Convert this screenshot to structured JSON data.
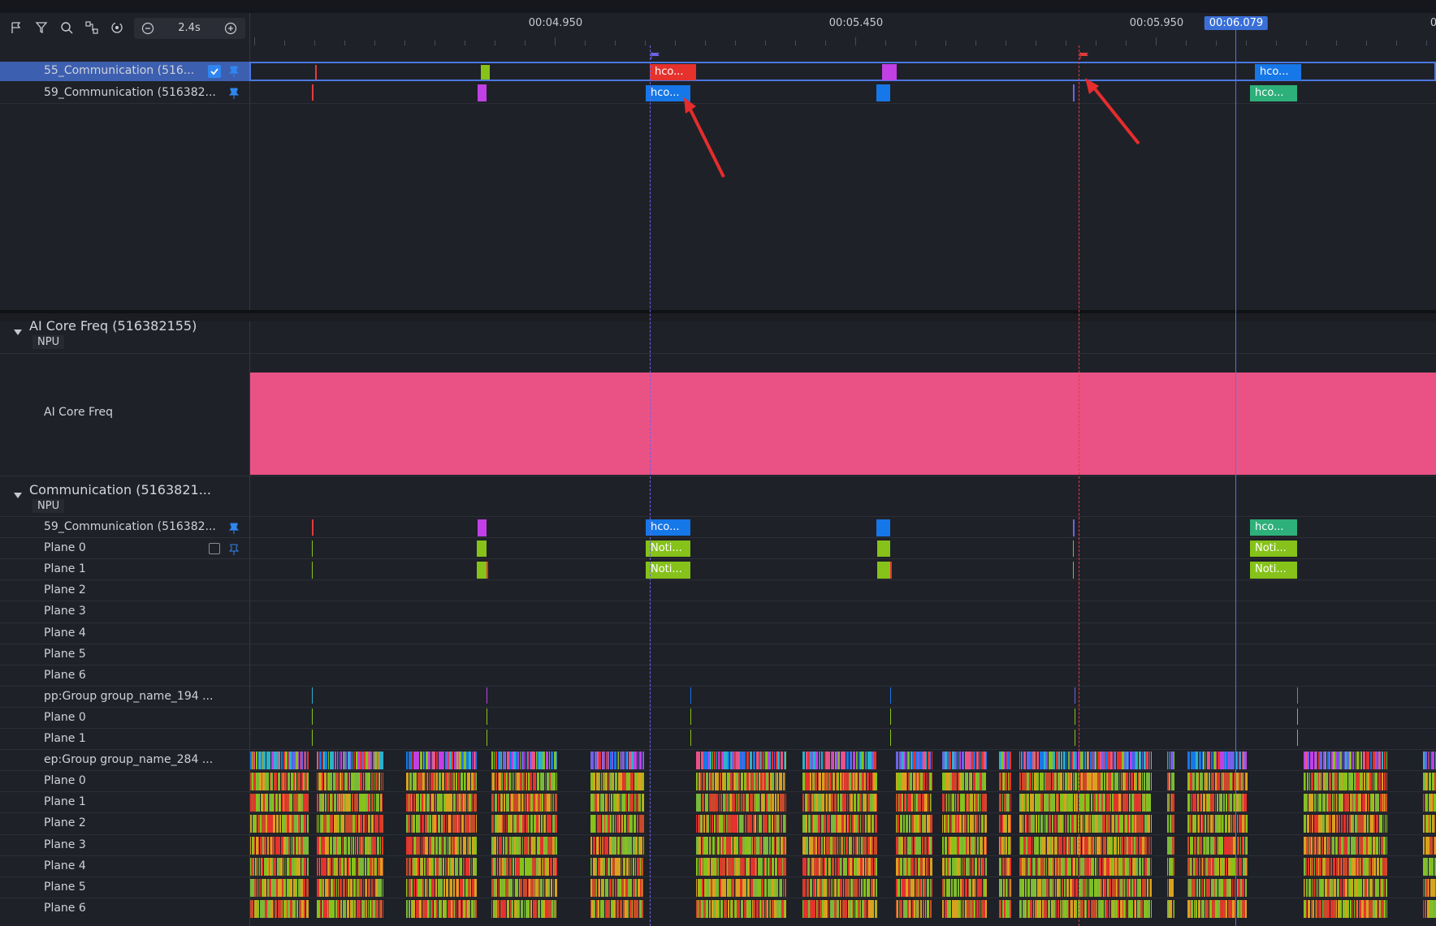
{
  "toolbar": {
    "icons": [
      "flag-icon",
      "filter-icon",
      "search-icon",
      "link-icon",
      "target-icon",
      "zoom-out-icon",
      "zoom-in-icon"
    ],
    "zoom_level": "2.4s"
  },
  "timeline": {
    "ticks": [
      "00:04.950",
      "00:05.450",
      "00:05.950"
    ],
    "cursor_time": "00:06.079",
    "edge_label": "0"
  },
  "top_rows": [
    {
      "label": "55_Communication (516...",
      "selected": true
    },
    {
      "label": "59_Communication (516382..."
    }
  ],
  "groups": {
    "ai_core": {
      "title": "AI Core Freq (516382155)",
      "tag": "NPU",
      "row_label": "AI Core Freq"
    },
    "communication": {
      "title": "Communication (5163821...",
      "tag": "NPU"
    }
  },
  "comm_rows": [
    "59_Communication (516382...",
    "Plane 0",
    "Plane 1",
    "Plane 2",
    "Plane 3",
    "Plane 4",
    "Plane 5",
    "Plane 6",
    "pp:Group group_name_194 ...",
    "Plane 0",
    "Plane 1",
    "ep:Group group_name_284 ...",
    "Plane 0",
    "Plane 1",
    "Plane 2",
    "Plane 3",
    "Plane 4",
    "Plane 5",
    "Plane 6"
  ],
  "slices": {
    "hco": "hco...",
    "noti": "Noti..."
  },
  "colors": {
    "ai_core_fill": "#ea5286",
    "selected_row": "#3d5fb0",
    "red_slice": "#e5322d",
    "blue_slice": "#1677e8",
    "green_slice": "#2eb07a",
    "lime": "#86c21a",
    "purple": "#c040e6",
    "flag_red": "#e33b3b",
    "flag_purple": "#6c63e8"
  }
}
